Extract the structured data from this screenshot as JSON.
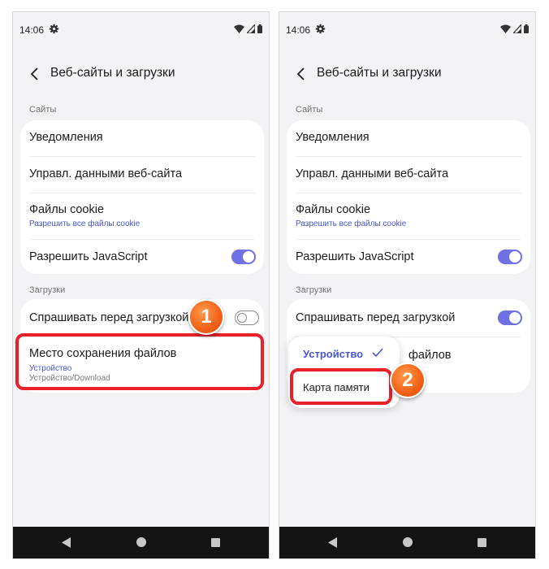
{
  "status_bar": {
    "time": "14:06"
  },
  "header": {
    "title": "Веб-сайты и загрузки"
  },
  "sections": {
    "sites": "Сайты",
    "downloads": "Загрузки"
  },
  "site_settings": {
    "notifications": "Уведомления",
    "manage_data": "Управл. данными веб-сайта",
    "cookies_title": "Файлы cookie",
    "cookies_subtitle": "Разрешить все файлы cookie",
    "javascript": "Разрешить JavaScript"
  },
  "downloads": {
    "ask_before": "Спрашивать перед загрузкой",
    "location_title": "Место сохранения файлов",
    "location_value": "Устройство",
    "location_path": "Устройство/Download"
  },
  "toggles": {
    "javascript": true,
    "ask_before_left": false,
    "ask_before_right": true
  },
  "location_popup": {
    "options": [
      "Устройство",
      "Карта памяти"
    ],
    "selected": "Устройство",
    "partial_label": "файлов"
  },
  "steps": [
    "1",
    "2"
  ],
  "colors": {
    "accent": "#6f70e3",
    "link_text": "#4a55d6",
    "highlight": "#e8202a",
    "badge": "#f3651b",
    "nav_bar": "#141414",
    "screen_background": "#f3f3f6"
  },
  "icons": [
    "gear-icon",
    "wifi-icon",
    "signal-icon",
    "battery-icon",
    "back-arrow-icon",
    "nav-back-icon",
    "nav-home-icon",
    "nav-recents-icon",
    "checkmark-icon"
  ]
}
